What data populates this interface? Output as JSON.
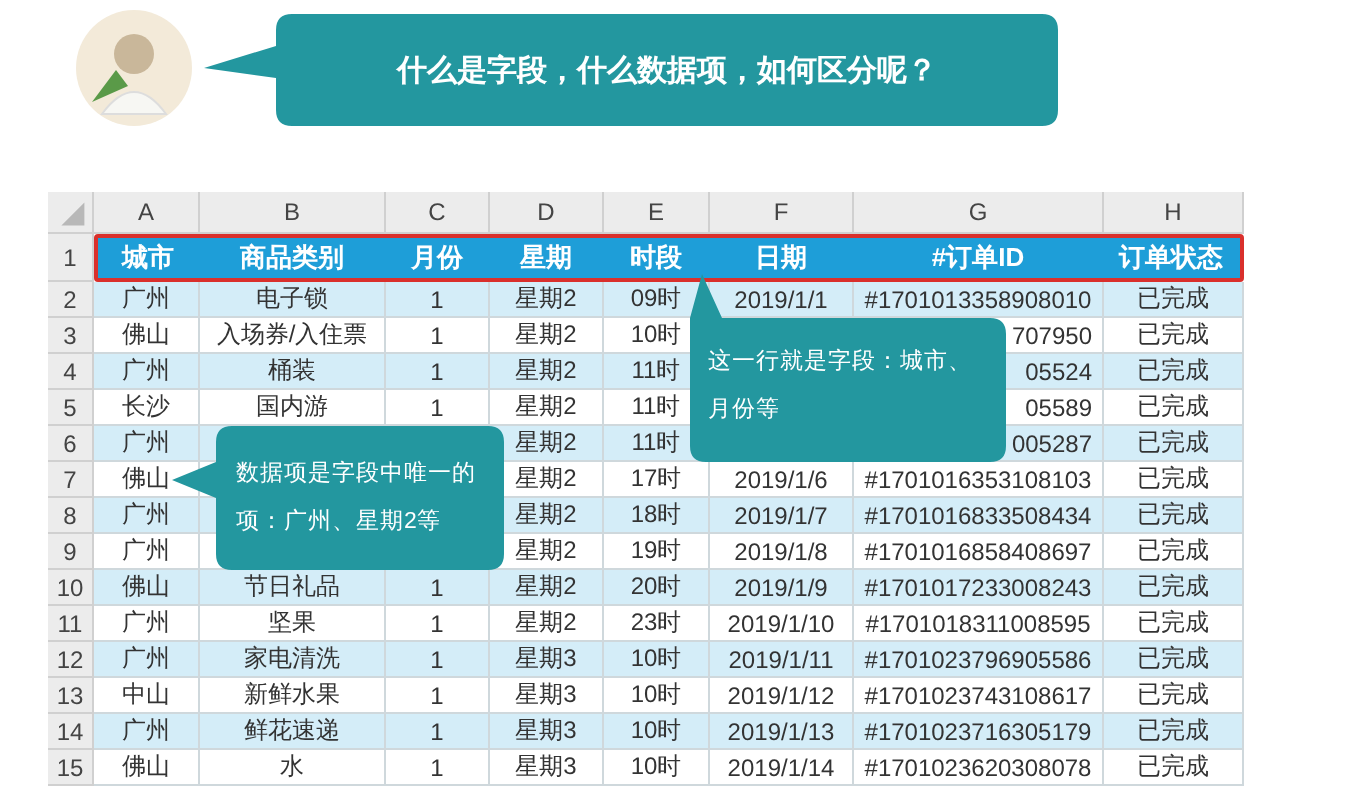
{
  "question": {
    "text": "什么是字段，什么数据项，如何区分呢？"
  },
  "sheet": {
    "columns": [
      "A",
      "B",
      "C",
      "D",
      "E",
      "F",
      "G",
      "H"
    ],
    "rows": [
      {
        "number": "1",
        "kind": "field",
        "highlighted": true,
        "cells": {
          "A": "城市",
          "B": "商品类别",
          "C": "月份",
          "D": "星期",
          "E": "时段",
          "F": "日期",
          "G": "#订单ID",
          "H": "订单状态"
        }
      },
      {
        "number": "2",
        "kind": "data",
        "highlighted": false,
        "cells": {
          "A": "广州",
          "B": "电子锁",
          "C": "1",
          "D": "星期2",
          "E": "09时",
          "F": "2019/1/1",
          "G": "#1701013358908010",
          "H": "已完成"
        }
      },
      {
        "number": "3",
        "kind": "data",
        "highlighted": false,
        "cells": {
          "A": "佛山",
          "B": "入场券/入住票",
          "C": "1",
          "D": "星期2",
          "E": "10时",
          "G": {
            "text": "707950",
            "clipped": true
          },
          "H": "已完成"
        }
      },
      {
        "number": "4",
        "kind": "data",
        "highlighted": false,
        "cells": {
          "A": "广州",
          "B": "桶装",
          "C": "1",
          "D": "星期2",
          "E": "11时",
          "G": {
            "text": "05524",
            "clipped": true
          },
          "H": "已完成"
        }
      },
      {
        "number": "5",
        "kind": "data",
        "highlighted": false,
        "cells": {
          "A": "长沙",
          "B": "国内游",
          "C": "1",
          "D": "星期2",
          "E": "11时",
          "G": {
            "text": "05589",
            "clipped": true
          },
          "H": "已完成"
        }
      },
      {
        "number": "6",
        "kind": "data",
        "highlighted": false,
        "cells": {
          "A": "广州",
          "D": "星期2",
          "E": "11时",
          "G": {
            "text": "005287",
            "clipped": true
          },
          "H": "已完成"
        }
      },
      {
        "number": "7",
        "kind": "data",
        "highlighted": false,
        "cells": {
          "A": "佛山",
          "D": "星期2",
          "E": "17时",
          "F": "2019/1/6",
          "G": "#1701016353108103",
          "H": "已完成"
        }
      },
      {
        "number": "8",
        "kind": "data",
        "highlighted": false,
        "cells": {
          "A": "广州",
          "D": "星期2",
          "E": "18时",
          "F": "2019/1/7",
          "G": "#1701016833508434",
          "H": "已完成"
        }
      },
      {
        "number": "9",
        "kind": "data",
        "highlighted": false,
        "cells": {
          "A": "广州",
          "D": "星期2",
          "E": "19时",
          "F": "2019/1/8",
          "G": "#1701016858408697",
          "H": "已完成"
        }
      },
      {
        "number": "10",
        "kind": "data",
        "highlighted": false,
        "cells": {
          "A": "佛山",
          "B": "节日礼品",
          "C": "1",
          "D": "星期2",
          "E": "20时",
          "F": "2019/1/9",
          "G": "#1701017233008243",
          "H": "已完成"
        }
      },
      {
        "number": "11",
        "kind": "data",
        "highlighted": false,
        "cells": {
          "A": "广州",
          "B": "坚果",
          "C": "1",
          "D": "星期2",
          "E": "23时",
          "F": "2019/1/10",
          "G": "#1701018311008595",
          "H": "已完成"
        }
      },
      {
        "number": "12",
        "kind": "data",
        "highlighted": false,
        "cells": {
          "A": "广州",
          "B": "家电清洗",
          "C": "1",
          "D": "星期3",
          "E": "10时",
          "F": "2019/1/11",
          "G": "#1701023796905586",
          "H": "已完成"
        }
      },
      {
        "number": "13",
        "kind": "data",
        "highlighted": false,
        "cells": {
          "A": "中山",
          "B": "新鲜水果",
          "C": "1",
          "D": "星期3",
          "E": "10时",
          "F": "2019/1/12",
          "G": "#1701023743108617",
          "H": "已完成"
        }
      },
      {
        "number": "14",
        "kind": "data",
        "highlighted": false,
        "cells": {
          "A": "广州",
          "B": "鲜花速递",
          "C": "1",
          "D": "星期3",
          "E": "10时",
          "F": "2019/1/13",
          "G": "#1701023716305179",
          "H": "已完成"
        }
      },
      {
        "number": "15",
        "kind": "data",
        "highlighted": false,
        "cells": {
          "A": "佛山",
          "B": "水",
          "C": "1",
          "D": "星期3",
          "E": "10时",
          "F": "2019/1/14",
          "G": "#1701023620308078",
          "H": "已完成"
        }
      }
    ]
  },
  "callouts": [
    {
      "kind": "up",
      "text": "这一行就是字段：城市、月份等"
    },
    {
      "kind": "left",
      "text": "数据项是字段中唯一的项：广州、星期2等"
    }
  ]
}
